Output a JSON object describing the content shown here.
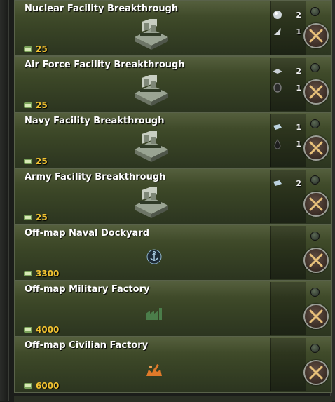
{
  "colors": {
    "card_bg": "#3a4526",
    "cost_text": "#f2c230",
    "title_text": "#ffffff",
    "button_border": "#9a9d95"
  },
  "cards": [
    {
      "title": "Nuclear Facility Breakthrough",
      "cost": "25",
      "icon": "facility-building-icon",
      "resources": [
        {
          "icon": "resource-orb-icon",
          "count": "2"
        },
        {
          "icon": "resource-shard-icon",
          "count": "1"
        }
      ]
    },
    {
      "title": "Air Force Facility Breakthrough",
      "cost": "25",
      "icon": "facility-building-icon",
      "resources": [
        {
          "icon": "resource-plate-icon",
          "count": "2"
        },
        {
          "icon": "resource-ring-icon",
          "count": "1"
        }
      ]
    },
    {
      "title": "Navy Facility Breakthrough",
      "cost": "25",
      "icon": "facility-building-icon",
      "resources": [
        {
          "icon": "resource-bar-icon",
          "count": "1"
        },
        {
          "icon": "resource-droplet-icon",
          "count": "1"
        }
      ]
    },
    {
      "title": "Army Facility Breakthrough",
      "cost": "25",
      "icon": "facility-building-icon",
      "resources": [
        {
          "icon": "resource-bar-icon",
          "count": "2"
        }
      ]
    },
    {
      "title": "Off-map Naval Dockyard",
      "cost": "3300",
      "icon": "anchor-icon",
      "resources": []
    },
    {
      "title": "Off-map Military Factory",
      "cost": "4000",
      "icon": "military-factory-icon",
      "resources": []
    },
    {
      "title": "Off-map Civilian Factory",
      "cost": "6000",
      "icon": "civilian-factory-icon",
      "resources": []
    }
  ]
}
